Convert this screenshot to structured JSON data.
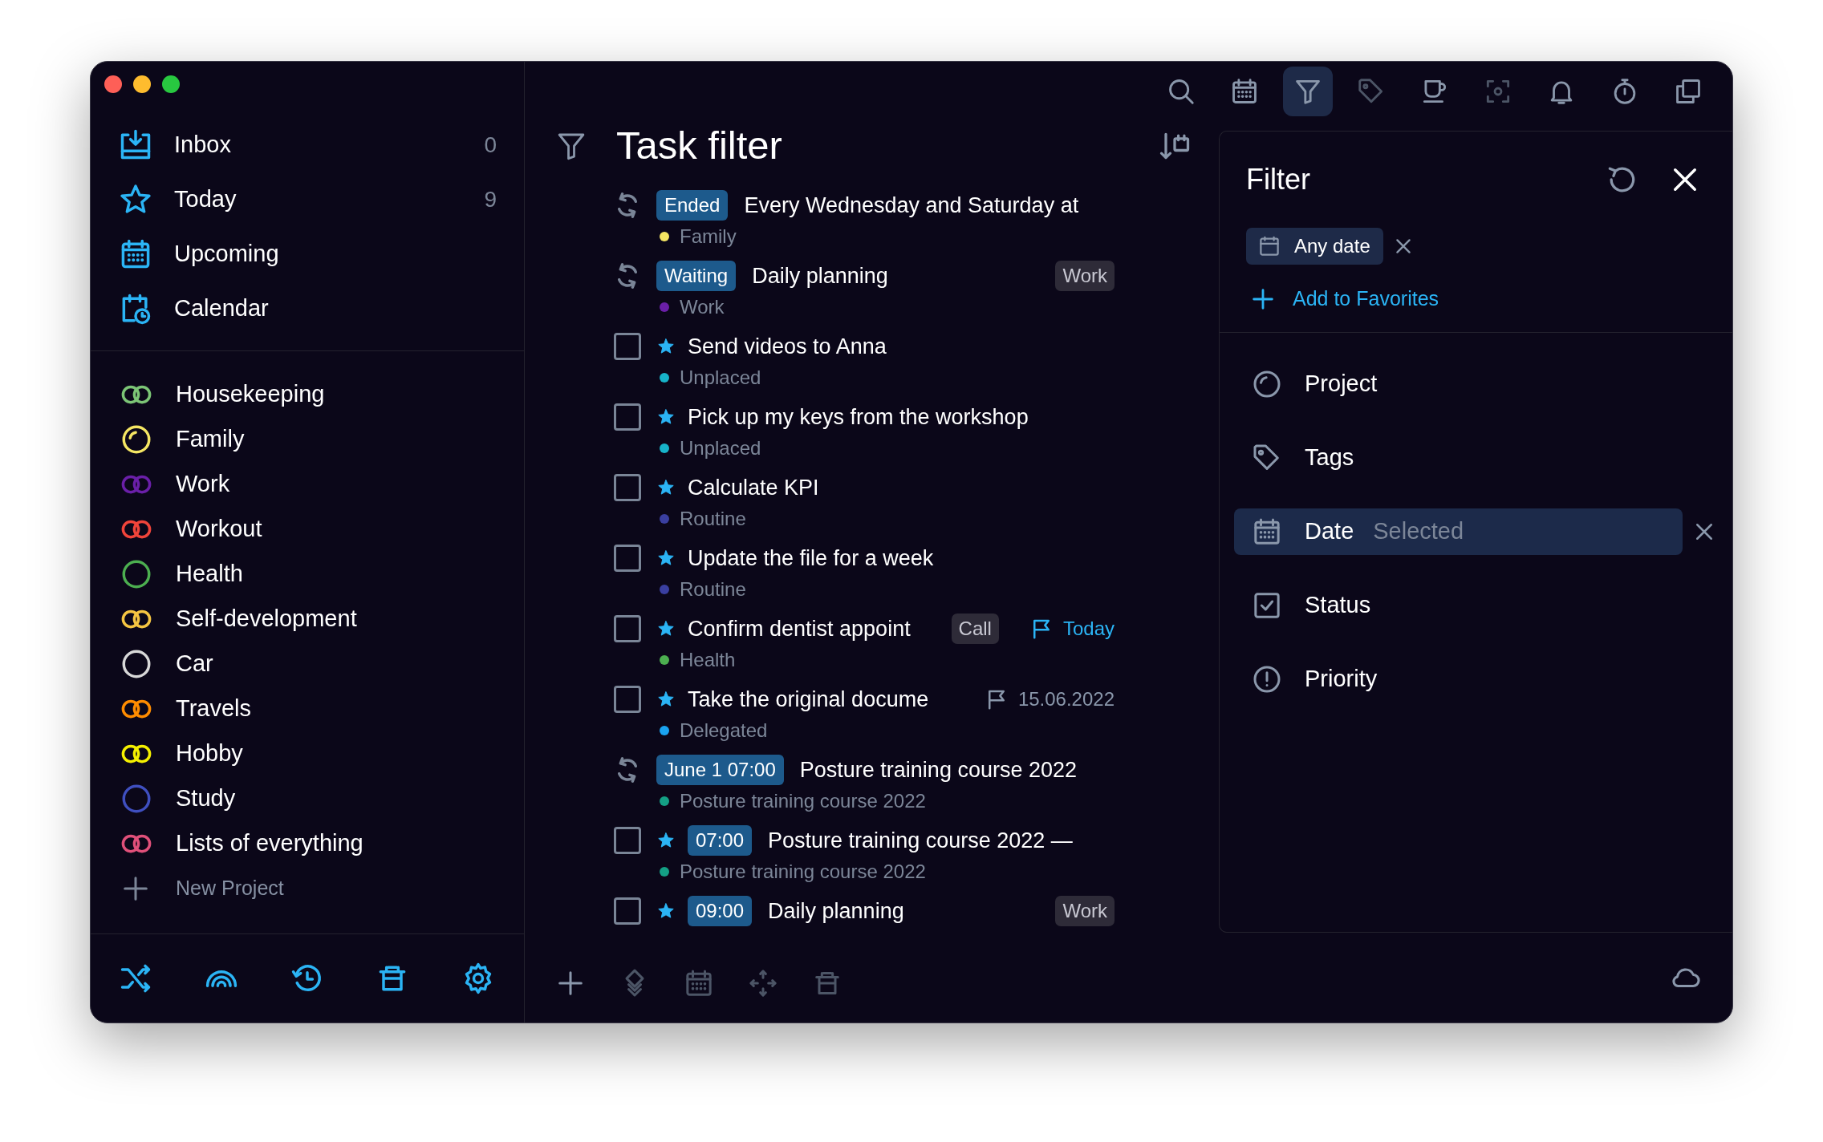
{
  "toolbar": [
    {
      "kind": "search",
      "selected": false,
      "disabled": false
    },
    {
      "kind": "calendar",
      "selected": false,
      "disabled": false
    },
    {
      "kind": "filter",
      "selected": true,
      "disabled": false
    },
    {
      "kind": "tag",
      "selected": false,
      "disabled": true
    },
    {
      "kind": "cup",
      "selected": false,
      "disabled": false
    },
    {
      "kind": "focus",
      "selected": false,
      "disabled": true
    },
    {
      "kind": "bell",
      "selected": false,
      "disabled": false
    },
    {
      "kind": "stopwatch",
      "selected": false,
      "disabled": false
    },
    {
      "kind": "copy",
      "selected": false,
      "disabled": false
    }
  ],
  "sidebar": {
    "smart_lists": [
      {
        "kind": "inbox",
        "label": "Inbox",
        "count": "0"
      },
      {
        "kind": "today",
        "label": "Today",
        "count": "9"
      },
      {
        "kind": "upcoming",
        "label": "Upcoming"
      },
      {
        "kind": "calendar",
        "label": "Calendar"
      }
    ],
    "projects": [
      {
        "kind": "double",
        "label": "Housekeeping",
        "color": "#7cc576"
      },
      {
        "kind": "partial",
        "label": "Family",
        "color": "#f5e663"
      },
      {
        "kind": "double",
        "label": "Work",
        "color": "#6a1fa8"
      },
      {
        "kind": "double",
        "label": "Workout",
        "color": "#f0443a"
      },
      {
        "kind": "ring",
        "label": "Health",
        "color": "#4caf50"
      },
      {
        "kind": "double",
        "label": "Self-development",
        "color": "#f5c542"
      },
      {
        "kind": "ring",
        "label": "Car",
        "color": "#d8d8d8"
      },
      {
        "kind": "double",
        "label": "Travels",
        "color": "#ff8c00"
      },
      {
        "kind": "double",
        "label": "Hobby",
        "color": "#f5f000"
      },
      {
        "kind": "ring",
        "label": "Study",
        "color": "#3f4fc0"
      },
      {
        "kind": "double",
        "label": "Lists of everything",
        "color": "#e0507a"
      }
    ],
    "new_project": "New Project"
  },
  "main": {
    "title": "Task filter",
    "tasks": [
      {
        "kind": "repeat",
        "starred": false,
        "badge": "Ended",
        "title": "Every Wednesday and Saturday at",
        "project": "Family",
        "color": "#f5e663"
      },
      {
        "kind": "repeat",
        "starred": false,
        "badge": "Waiting",
        "title": "Daily planning",
        "tag": "Work",
        "project": "Work",
        "color": "#6a1fa8"
      },
      {
        "kind": "checkbox",
        "checked": false,
        "starred": true,
        "title": "Send videos to Anna",
        "project": "Unplaced",
        "color": "#17b3c9"
      },
      {
        "kind": "checkbox",
        "checked": false,
        "starred": true,
        "title": "Pick up my keys from the workshop",
        "project": "Unplaced",
        "color": "#17b3c9"
      },
      {
        "kind": "checkbox",
        "checked": false,
        "starred": true,
        "title": "Calculate KPI",
        "project": "Routine",
        "color": "#3a3fa0"
      },
      {
        "kind": "checkbox",
        "checked": false,
        "starred": true,
        "title": "Update the file for a week",
        "project": "Routine",
        "color": "#3a3fa0"
      },
      {
        "kind": "checkbox",
        "checked": false,
        "starred": true,
        "title": "Confirm dentist appoint",
        "tag": "Call",
        "flag": {
          "label": "Today",
          "highlighted": true
        },
        "project": "Health",
        "color": "#4caf50"
      },
      {
        "kind": "checkbox",
        "checked": false,
        "starred": true,
        "title": "Take the original docume",
        "flag": {
          "label": "15.06.2022",
          "highlighted": false
        },
        "project": "Delegated",
        "color": "#1aa3f0"
      },
      {
        "kind": "repeat",
        "starred": false,
        "badge": "June 1 07:00",
        "title": "Posture training course 2022",
        "project": "Posture training course 2022",
        "color": "#14a085"
      },
      {
        "kind": "checkbox",
        "checked": false,
        "starred": true,
        "badge": "07:00",
        "title": "Posture training course 2022 —",
        "project": "Posture training course 2022",
        "color": "#14a085"
      },
      {
        "kind": "checkbox",
        "checked": false,
        "starred": true,
        "badge": "09:00",
        "title": "Daily planning",
        "tag": "Work"
      }
    ]
  },
  "filter_panel": {
    "title": "Filter",
    "chips": [
      {
        "label": "Any date"
      }
    ],
    "add_favorites": "Add to Favorites",
    "criteria": [
      {
        "kind": "project",
        "label": "Project",
        "selected": false
      },
      {
        "kind": "tags",
        "label": "Tags",
        "selected": false
      },
      {
        "kind": "date",
        "label": "Date",
        "value": "Selected",
        "selected": true
      },
      {
        "kind": "status",
        "label": "Status",
        "selected": false
      },
      {
        "kind": "priority",
        "label": "Priority",
        "selected": false
      }
    ]
  }
}
